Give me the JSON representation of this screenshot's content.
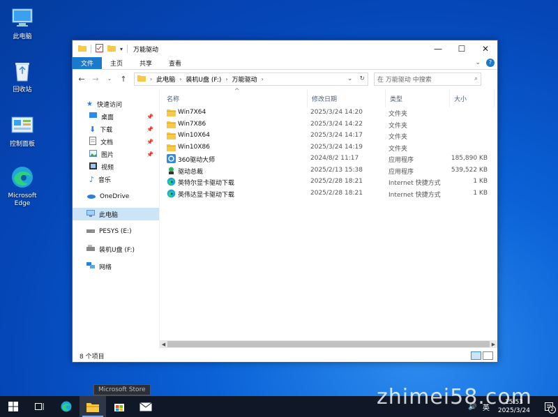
{
  "desktop": {
    "icons": [
      {
        "label": "此电脑"
      },
      {
        "label": "回收站"
      },
      {
        "label": "控制面板"
      },
      {
        "label": "Microsoft Edge"
      }
    ]
  },
  "window": {
    "title": "万能驱动",
    "ribbon_tabs": [
      "文件",
      "主页",
      "共享",
      "查看"
    ],
    "address": {
      "crumbs": [
        "此电脑",
        "装机U盘 (F:)",
        "万能驱动"
      ]
    },
    "search": {
      "placeholder": "在 万能驱动 中搜索"
    },
    "nav": {
      "quick_access": "快速访问",
      "quick_items": [
        "桌面",
        "下载",
        "文档",
        "图片",
        "视频",
        "音乐"
      ],
      "onedrive": "OneDrive",
      "this_pc": "此电脑",
      "drive_e": "PESYS (E:)",
      "drive_f": "装机U盘 (F:)",
      "network": "网络"
    },
    "columns": {
      "name": "名称",
      "date": "修改日期",
      "type": "类型",
      "size": "大小"
    },
    "files": [
      {
        "name": "Win7X64",
        "date": "2025/3/24 14:20",
        "type": "文件夹",
        "size": "",
        "icon": "folder"
      },
      {
        "name": "Win7X86",
        "date": "2025/3/24 14:22",
        "type": "文件夹",
        "size": "",
        "icon": "folder"
      },
      {
        "name": "Win10X64",
        "date": "2025/3/24 14:17",
        "type": "文件夹",
        "size": "",
        "icon": "folder"
      },
      {
        "name": "Win10X86",
        "date": "2025/3/24 14:19",
        "type": "文件夹",
        "size": "",
        "icon": "folder"
      },
      {
        "name": "360驱动大师",
        "date": "2024/8/2 11:17",
        "type": "应用程序",
        "size": "185,890 KB",
        "icon": "app-360"
      },
      {
        "name": "驱动总裁",
        "date": "2025/2/13 15:38",
        "type": "应用程序",
        "size": "539,522 KB",
        "icon": "app-driver"
      },
      {
        "name": "英特尔显卡驱动下载",
        "date": "2025/2/28 18:21",
        "type": "Internet 快捷方式",
        "size": "1 KB",
        "icon": "edge"
      },
      {
        "name": "英伟达显卡驱动下载",
        "date": "2025/2/28 18:21",
        "type": "Internet 快捷方式",
        "size": "1 KB",
        "icon": "edge"
      }
    ],
    "status": "8 个项目"
  },
  "taskbar": {
    "tooltip": "Microsoft Store",
    "ime": "英",
    "time": "15:53",
    "date": "2025/3/24",
    "notif_count": "2"
  },
  "watermark": "zhimei58.com",
  "colors": {
    "accent": "#1979ca",
    "selected": "#cce4f7",
    "folder": "#f7c948"
  }
}
